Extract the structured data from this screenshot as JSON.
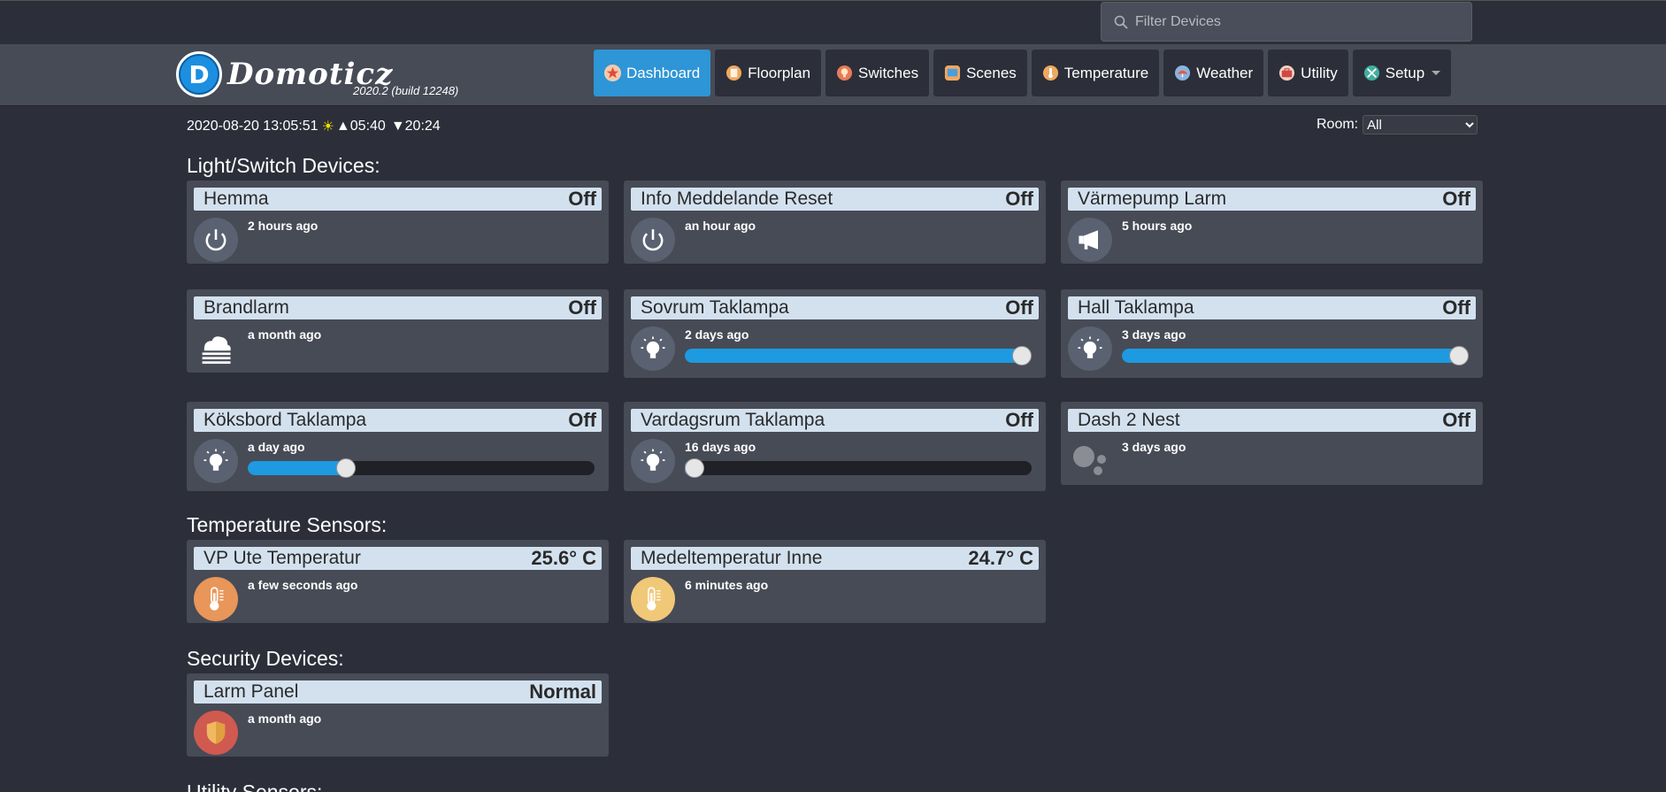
{
  "search": {
    "placeholder": "Filter Devices"
  },
  "header": {
    "logo_letter": "D",
    "logo_text": "Domoticz",
    "version": "2020.2 (build 12248)"
  },
  "nav": [
    {
      "label": "Dashboard",
      "icon": "star-icon",
      "color": "#e05a4a"
    },
    {
      "label": "Floorplan",
      "icon": "floorplan-icon",
      "color": "#e8a050"
    },
    {
      "label": "Switches",
      "icon": "lightbulb-icon",
      "color": "#e86a50"
    },
    {
      "label": "Scenes",
      "icon": "scenes-icon",
      "color": "#4a9ee0"
    },
    {
      "label": "Temperature",
      "icon": "thermometer-icon",
      "color": "#e8a050"
    },
    {
      "label": "Weather",
      "icon": "weather-icon",
      "color": "#4a9ee0"
    },
    {
      "label": "Utility",
      "icon": "toolbox-icon",
      "color": "#d05050"
    },
    {
      "label": "Setup",
      "icon": "wrench-icon",
      "color": "#40b0a0"
    }
  ],
  "info": {
    "datetime": "2020-08-20 13:05:51",
    "sunrise": "05:40",
    "sunset": "20:24",
    "room_label": "Room:",
    "room_value": "All"
  },
  "sections": {
    "light": "Light/Switch Devices:",
    "temp": "Temperature Sensors:",
    "security": "Security Devices:",
    "utility": "Utility Sensors:"
  },
  "devices": [
    {
      "name": "Hemma",
      "status": "Off",
      "time": "2 hours ago",
      "icon": "power-icon"
    },
    {
      "name": "Info Meddelande Reset",
      "status": "Off",
      "time": "an hour ago",
      "icon": "power-icon"
    },
    {
      "name": "Värmepump Larm",
      "status": "Off",
      "time": "5 hours ago",
      "icon": "megaphone-icon"
    },
    {
      "name": "Brandlarm",
      "status": "Off",
      "time": "a month ago",
      "icon": "smoke-icon"
    },
    {
      "name": "Sovrum Taklampa",
      "status": "Off",
      "time": "2 days ago",
      "icon": "lightbulb-icon",
      "level": 1.0
    },
    {
      "name": "Hall Taklampa",
      "status": "Off",
      "time": "3 days ago",
      "icon": "lightbulb-icon",
      "level": 1.0
    },
    {
      "name": "Köksbord Taklampa",
      "status": "Off",
      "time": "a day ago",
      "icon": "lightbulb-icon",
      "level": 0.27
    },
    {
      "name": "Vardagsrum Taklampa",
      "status": "Off",
      "time": "16 days ago",
      "icon": "lightbulb-icon",
      "level": 0.0
    },
    {
      "name": "Dash 2 Nest",
      "status": "Off",
      "time": "3 days ago",
      "icon": "bubbles-icon"
    }
  ],
  "temps": [
    {
      "name": "VP Ute Temperatur",
      "status": "25.6° C",
      "time": "a few seconds ago",
      "icon": "thermometer-icon",
      "color": "#e8965a"
    },
    {
      "name": "Medeltemperatur Inne",
      "status": "24.7° C",
      "time": "6 minutes ago",
      "icon": "thermometer-icon",
      "color": "#f0c878"
    }
  ],
  "security": [
    {
      "name": "Larm Panel",
      "status": "Normal",
      "time": "a month ago",
      "icon": "shield-icon"
    }
  ]
}
